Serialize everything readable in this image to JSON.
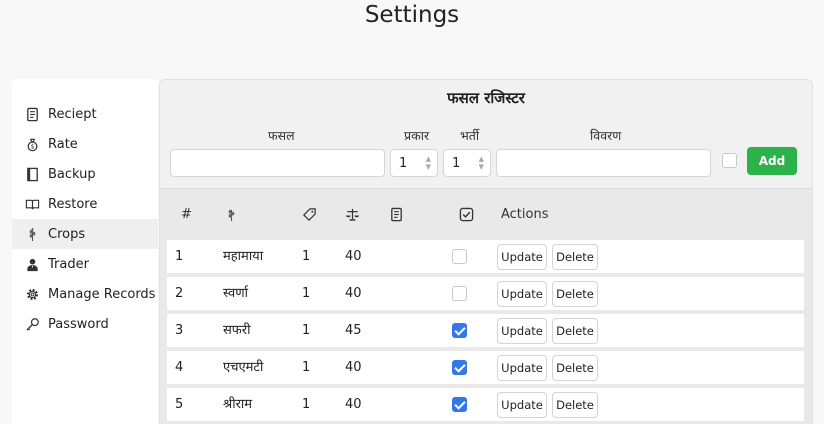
{
  "page": {
    "title": "Settings"
  },
  "sidebar": {
    "items": [
      {
        "label": "Reciept",
        "icon": "receipt-icon"
      },
      {
        "label": "Rate",
        "icon": "money-bag-icon"
      },
      {
        "label": "Backup",
        "icon": "book-icon"
      },
      {
        "label": "Restore",
        "icon": "open-book-icon"
      },
      {
        "label": "Crops",
        "icon": "crop-icon",
        "active": true
      },
      {
        "label": "Trader",
        "icon": "trader-icon"
      },
      {
        "label": "Manage Records",
        "icon": "gear-icon"
      },
      {
        "label": "Password",
        "icon": "key-icon"
      }
    ]
  },
  "panel": {
    "title": "फसल रजिस्टर",
    "form": {
      "crop_label": "फसल",
      "type_label": "प्रकार",
      "filling_label": "भर्ती",
      "desc_label": "विवरण",
      "crop_value": "",
      "type_value": "1",
      "filling_value": "1",
      "desc_value": "",
      "checked": false,
      "add_label": "Add"
    },
    "table": {
      "headers": {
        "index": "#",
        "actions": "Actions"
      },
      "rows": [
        {
          "index": "1",
          "name": "महामाया",
          "type": "1",
          "filling": "40",
          "checked": false
        },
        {
          "index": "2",
          "name": "स्वर्णा",
          "type": "1",
          "filling": "40",
          "checked": false
        },
        {
          "index": "3",
          "name": "सफरी",
          "type": "1",
          "filling": "45",
          "checked": true
        },
        {
          "index": "4",
          "name": "एचएमटी",
          "type": "1",
          "filling": "40",
          "checked": true
        },
        {
          "index": "5",
          "name": "श्रीराम",
          "type": "1",
          "filling": "40",
          "checked": true
        }
      ],
      "update_label": "Update",
      "delete_label": "Delete"
    }
  },
  "colors": {
    "accent_green": "#2cb24a",
    "checkbox_blue": "#3478e5"
  }
}
